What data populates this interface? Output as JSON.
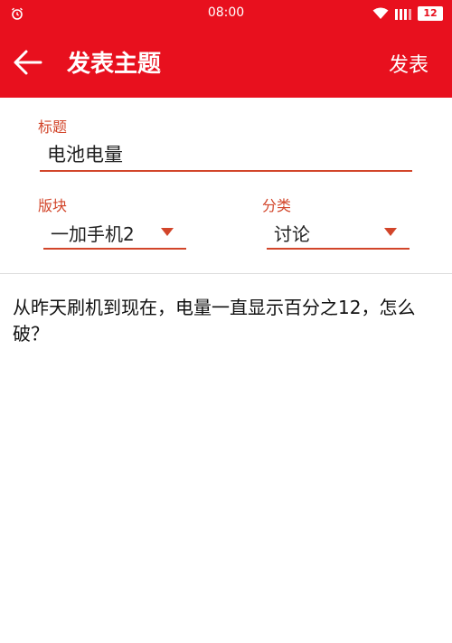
{
  "status_bar": {
    "time": "08:00",
    "battery": "12"
  },
  "toolbar": {
    "title": "发表主题",
    "publish_label": "发表"
  },
  "form": {
    "title_label": "标题",
    "title_value": "电池电量",
    "section_label": "版块",
    "section_value": "一加手机2",
    "category_label": "分类",
    "category_value": "讨论"
  },
  "content": {
    "body": "从昨天刷机到现在，电量一直显示百分之12，怎么破？"
  },
  "colors": {
    "primary": "#e8101e",
    "accent": "#d2452a"
  }
}
